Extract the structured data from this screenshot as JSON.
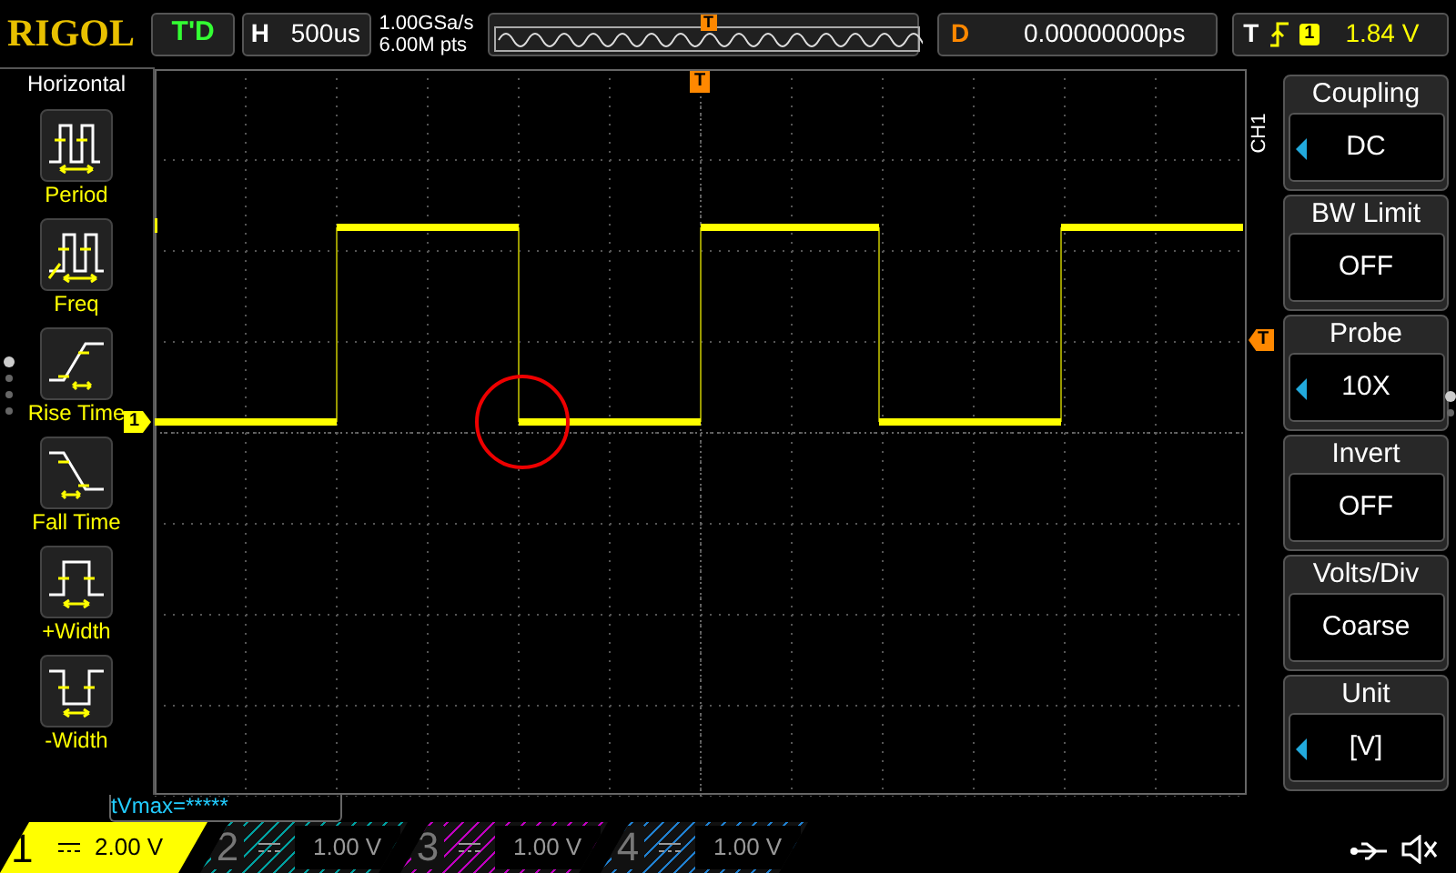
{
  "top_bar": {
    "brand": "RIGOL",
    "run_state": "T'D",
    "horizontal": {
      "label": "H",
      "value": "500us"
    },
    "sample_rate": "1.00GSa/s",
    "memory_depth": "6.00M pts",
    "overview_marker": "T",
    "delay": {
      "label": "D",
      "value": "0.00000000ps"
    },
    "trigger": {
      "label": "T",
      "source": "1",
      "level": "1.84 V"
    }
  },
  "left_menu": {
    "title": "Horizontal",
    "items": [
      {
        "kind": "period",
        "label": "Period"
      },
      {
        "kind": "freq",
        "label": "Freq"
      },
      {
        "kind": "rise",
        "label": "Rise Time"
      },
      {
        "kind": "fall",
        "label": "Fall Time"
      },
      {
        "kind": "pos_width",
        "label": "+Width"
      },
      {
        "kind": "neg_width",
        "label": "-Width"
      }
    ]
  },
  "grid": {
    "trigger_marker": "T",
    "channel_marker": "1",
    "level_marker": "T"
  },
  "right_menu": {
    "title": "CH1",
    "items": [
      {
        "label": "Coupling",
        "value": "DC",
        "adjustable": true
      },
      {
        "label": "BW Limit",
        "value": "OFF",
        "adjustable": false
      },
      {
        "label": "Probe",
        "value": "10X",
        "adjustable": true
      },
      {
        "label": "Invert",
        "value": "OFF",
        "adjustable": false
      },
      {
        "label": "Volts/Div",
        "value": "Coarse",
        "adjustable": false
      },
      {
        "label": "Unit",
        "value": "[V]",
        "adjustable": true
      }
    ]
  },
  "measurement": "tVmax=*****",
  "channels": [
    {
      "number": "1",
      "scale": "2.00 V",
      "active": true,
      "color": "#ffff00"
    },
    {
      "number": "2",
      "scale": "1.00 V",
      "active": false,
      "color": "#00a0a0"
    },
    {
      "number": "3",
      "scale": "1.00 V",
      "active": false,
      "color": "#c000c0"
    },
    {
      "number": "4",
      "scale": "1.00 V",
      "active": false,
      "color": "#2080d0"
    }
  ]
}
